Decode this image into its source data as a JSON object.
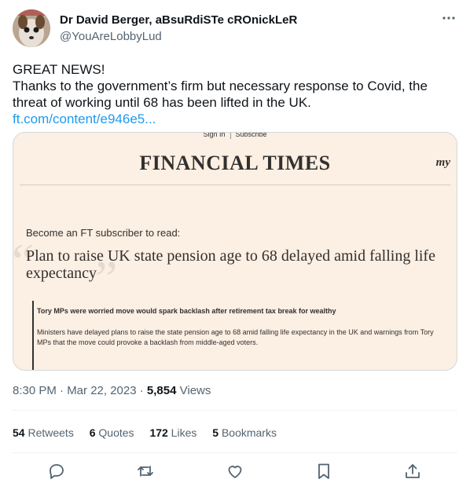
{
  "author": {
    "display_name": "Dr David Berger, aBsuRdiSTe cROnickLeR",
    "handle": "@YouAreLobbyLud"
  },
  "tweet": {
    "line1": "GREAT NEWS!",
    "line2": "Thanks to the government’s firm but necessary response to Covid, the",
    "line3": "threat of working until 68 has been lifted in the UK.",
    "link": "ft.com/content/e946e5..."
  },
  "card": {
    "top_links": [
      "Sign In",
      "Subscribe"
    ],
    "masthead": "FINANCIAL TIMES",
    "corner_logo": "my",
    "subscribe_prompt": "Become an FT subscriber to read:",
    "headline": "Plan to raise UK state pension age to 68 delayed amid falling life expectancy",
    "standfirst": "Tory MPs were worried move would spark backlash after retirement tax break for wealthy",
    "paragraph": "Ministers have delayed plans to raise the state pension age to 68 amid falling life expectancy in the UK and warnings from Tory MPs that the move could provoke a backlash from middle-aged voters."
  },
  "meta": {
    "time": "8:30 PM · Mar 22, 2023 · ",
    "views_count": "5,854",
    "views_label": " Views"
  },
  "stats": {
    "retweets_count": "54",
    "retweets_label": " Retweets",
    "quotes_count": "6",
    "quotes_label": " Quotes",
    "likes_count": "172",
    "likes_label": " Likes",
    "bookmarks_count": "5",
    "bookmarks_label": " Bookmarks"
  },
  "icons": [
    "more-icon",
    "reply-icon",
    "retweet-icon",
    "like-icon",
    "bookmark-icon",
    "share-icon"
  ],
  "colors": {
    "link": "#1d9bf0",
    "secondary_text": "#536471",
    "card_bg": "#fcefe3",
    "action_icon": "#536471"
  }
}
